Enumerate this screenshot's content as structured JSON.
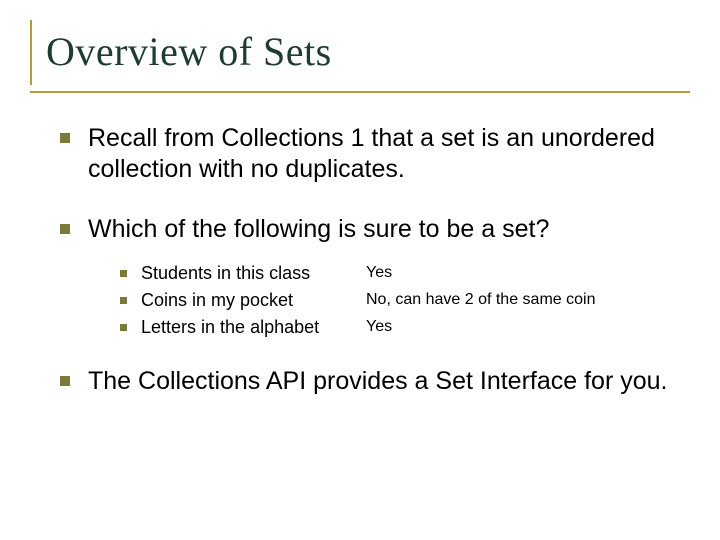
{
  "title": "Overview of Sets",
  "bullets": {
    "b1": "Recall from Collections 1 that a set is an unordered collection with no duplicates.",
    "b2": "Which of the following is sure to be a set?",
    "b3": "The Collections API provides a Set Interface for you."
  },
  "sub": {
    "s1": {
      "text": "Students in this class",
      "answer": "Yes"
    },
    "s2": {
      "text": "Coins in my pocket",
      "answer": "No, can have 2 of the same coin"
    },
    "s3": {
      "text": "Letters in the alphabet",
      "answer": "Yes"
    }
  }
}
